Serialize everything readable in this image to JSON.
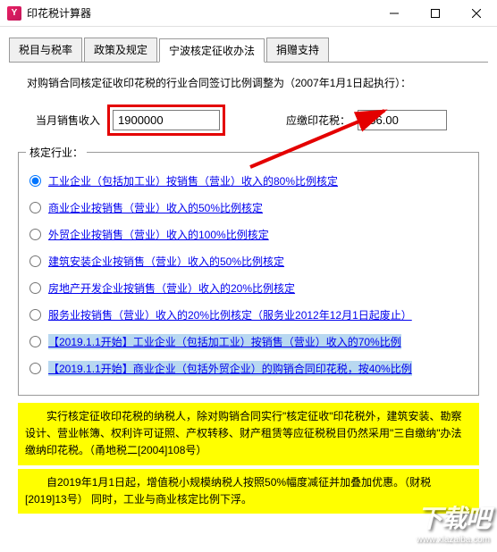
{
  "window": {
    "title": "印花税计算器",
    "icon_letter": "Y"
  },
  "tabs": {
    "items": [
      {
        "label": "税目与税率"
      },
      {
        "label": "政策及规定"
      },
      {
        "label": "宁波核定征收办法"
      },
      {
        "label": "捐赠支持"
      }
    ],
    "active_index": 2
  },
  "intro": "对购销合同核定征收印花税的行业合同签订比例调整为（2007年1月1日起执行）：",
  "inputs": {
    "sales_label": "当月销售收入",
    "sales_value": "1900000",
    "tax_label": "应缴印花税：",
    "tax_value": "456.00"
  },
  "fieldset_legend": "核定行业：",
  "options": [
    {
      "label": "工业企业（包括加工业）按销售（营业）收入的80%比例核定",
      "checked": true,
      "hl": false
    },
    {
      "label": "商业企业按销售（营业）收入的50%比例核定",
      "checked": false,
      "hl": false
    },
    {
      "label": "外贸企业按销售（营业）收入的100%比例核定",
      "checked": false,
      "hl": false
    },
    {
      "label": "建筑安装企业按销售（营业）收入的50%比例核定",
      "checked": false,
      "hl": false
    },
    {
      "label": "房地产开发企业按销售（营业）收入的20%比例核定",
      "checked": false,
      "hl": false
    },
    {
      "label": "服务业按销售（营业）收入的20%比例核定（服务业2012年12月1日起废止）",
      "checked": false,
      "hl": false
    },
    {
      "label": "【2019.1.1开始】工业企业（包括加工业）按销售（营业）收入的70%比例",
      "checked": false,
      "hl": true
    },
    {
      "label": "【2019.1.1开始】商业企业（包括外贸企业）的购销合同印花税，按40%比例",
      "checked": false,
      "hl": true
    }
  ],
  "notes": [
    "　　实行核定征收印花税的纳税人，除对购销合同实行\"核定征收\"印花税外，建筑安装、勘察设计、营业帐簿、权利许可证照、产权转移、财产租赁等应征税税目仍然采用\"三自缴纳\"办法缴纳印花税。（甬地税二[2004]108号）",
    "　　自2019年1月1日起，增值税小规模纳税人按照50%幅度减征并加叠加优惠。（财税[2019]13号）\n同时，工业与商业核定比例下浮。"
  ],
  "watermark": {
    "logo": "下载吧",
    "url": "www.xiazaiba.com"
  }
}
